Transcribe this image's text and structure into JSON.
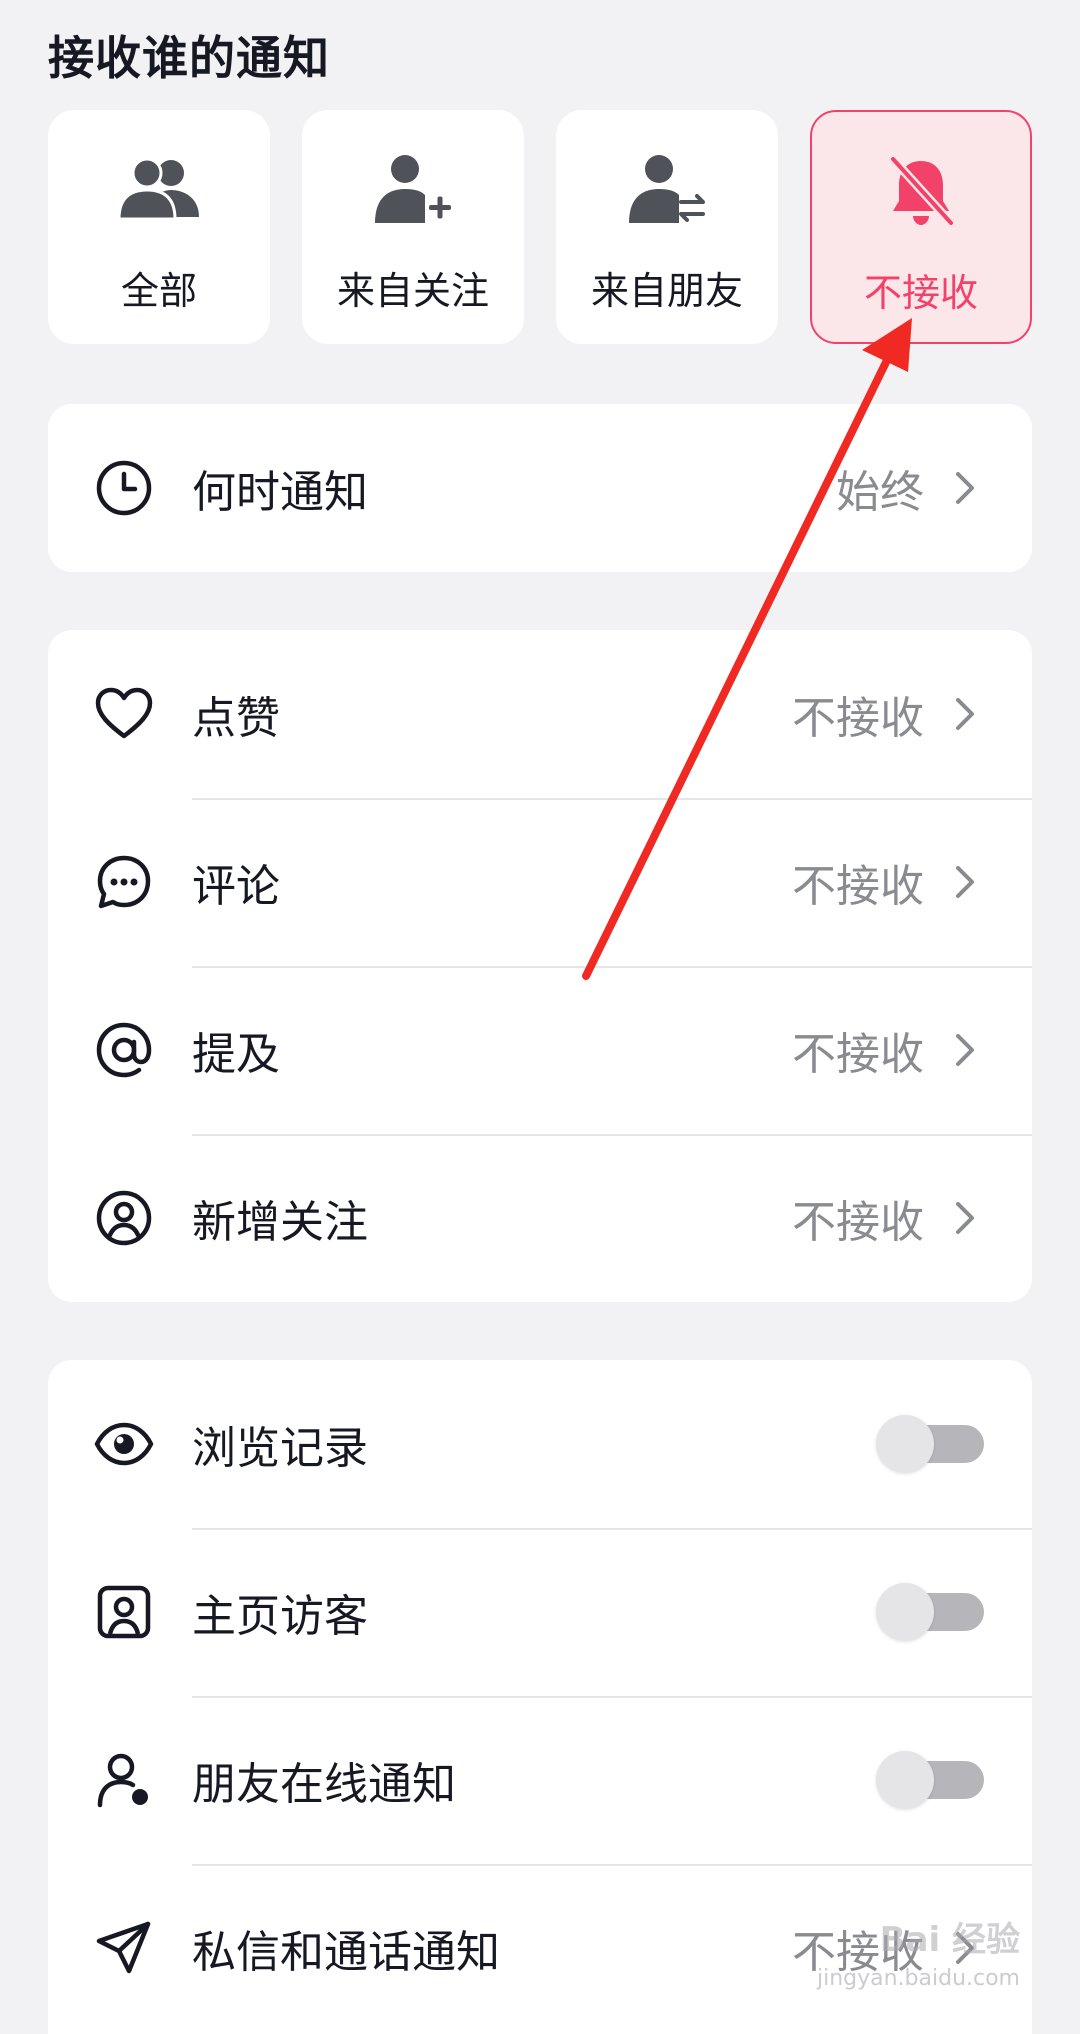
{
  "section_title": "接收谁的通知",
  "options": [
    {
      "label": "全部",
      "icon": "group-icon",
      "selected": false
    },
    {
      "label": "来自关注",
      "icon": "user-plus-icon",
      "selected": false
    },
    {
      "label": "来自朋友",
      "icon": "user-swap-icon",
      "selected": false
    },
    {
      "label": "不接收",
      "icon": "bell-off-icon",
      "selected": true
    }
  ],
  "when": {
    "label": "何时通知",
    "value": "始终",
    "icon": "clock-icon"
  },
  "notify_types": [
    {
      "label": "点赞",
      "value": "不接收",
      "icon": "heart-icon"
    },
    {
      "label": "评论",
      "value": "不接收",
      "icon": "comment-icon"
    },
    {
      "label": "提及",
      "value": "不接收",
      "icon": "at-icon"
    },
    {
      "label": "新增关注",
      "value": "不接收",
      "icon": "user-circle-icon"
    }
  ],
  "toggles": [
    {
      "label": "浏览记录",
      "icon": "eye-icon",
      "on": false
    },
    {
      "label": "主页访客",
      "icon": "profile-frame-icon",
      "on": false
    },
    {
      "label": "朋友在线通知",
      "icon": "user-online-icon",
      "on": false
    }
  ],
  "message": {
    "label": "私信和通话通知",
    "value": "不接收",
    "icon": "send-icon"
  },
  "watermark": {
    "text": "Bai 经验",
    "url": "jingyan.baidu.com"
  },
  "colors": {
    "accent": "#f2426a",
    "annotation_arrow": "#f02a22"
  }
}
